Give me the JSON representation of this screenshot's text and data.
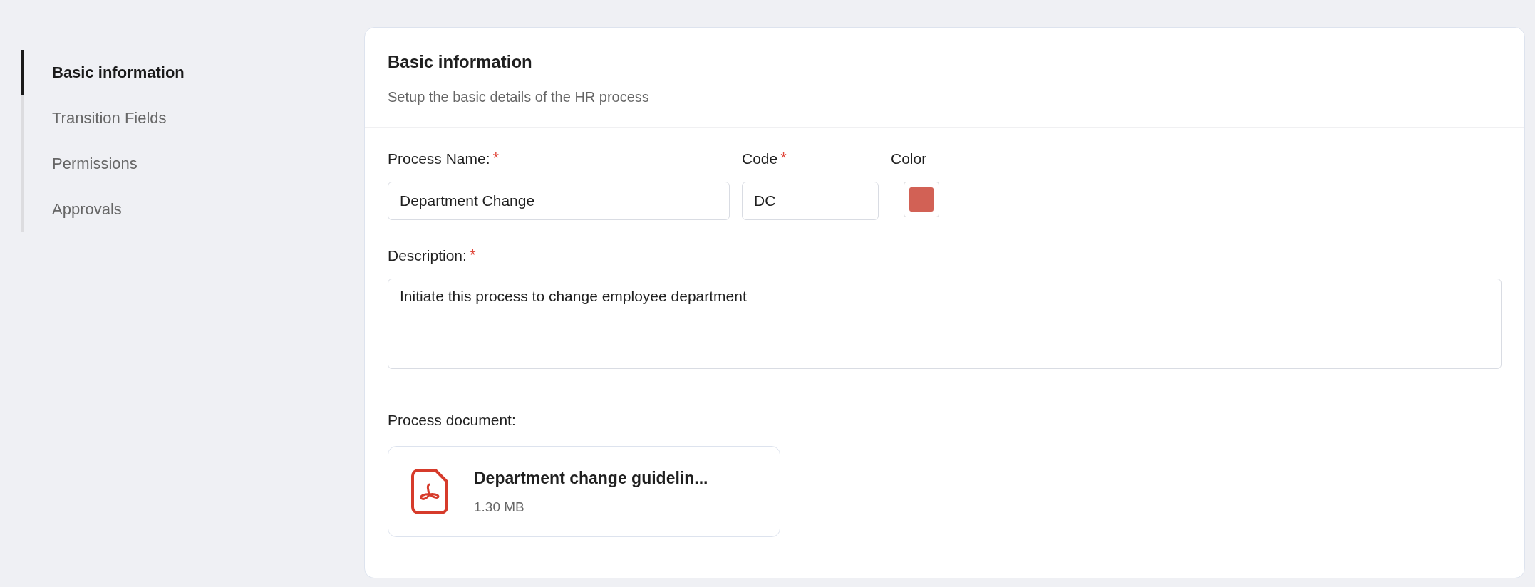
{
  "sidebar": {
    "items": [
      {
        "label": "Basic information",
        "selected": true
      },
      {
        "label": "Transition Fields",
        "selected": false
      },
      {
        "label": "Permissions",
        "selected": false
      },
      {
        "label": "Approvals",
        "selected": false
      }
    ]
  },
  "section": {
    "title": "Basic information",
    "subtitle": "Setup the basic details of the HR process"
  },
  "fields": {
    "process_name": {
      "label": "Process Name:",
      "required_mark": "*",
      "value": "Department Change"
    },
    "code": {
      "label": "Code",
      "required_mark": "*",
      "value": "DC"
    },
    "color": {
      "label": "Color",
      "color": "#d26155"
    },
    "description": {
      "label": "Description:",
      "required_mark": "*",
      "value": "Initiate this process to change employee department"
    }
  },
  "process_document": {
    "label": "Process document:",
    "file": {
      "name": "Department change guidelin...",
      "size": "1.30 MB"
    }
  }
}
